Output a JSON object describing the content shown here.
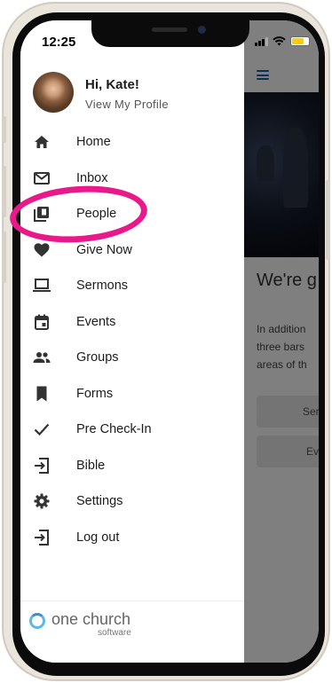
{
  "status_bar": {
    "time": "12:25"
  },
  "user": {
    "greeting": "Hi, Kate!",
    "view_profile": "View My Profile"
  },
  "menu": {
    "items": [
      {
        "label": "Home",
        "icon": "home-icon"
      },
      {
        "label": "Inbox",
        "icon": "mail-icon"
      },
      {
        "label": "People",
        "icon": "people-directory-icon"
      },
      {
        "label": "Give Now",
        "icon": "heart-icon"
      },
      {
        "label": "Sermons",
        "icon": "laptop-icon"
      },
      {
        "label": "Events",
        "icon": "calendar-icon"
      },
      {
        "label": "Groups",
        "icon": "groups-icon"
      },
      {
        "label": "Forms",
        "icon": "bookmark-icon"
      },
      {
        "label": "Pre Check-In",
        "icon": "checkmark-icon"
      },
      {
        "label": "Bible",
        "icon": "exit-to-app-icon"
      },
      {
        "label": "Settings",
        "icon": "gear-icon"
      },
      {
        "label": "Log out",
        "icon": "logout-icon"
      }
    ],
    "highlighted": "People"
  },
  "brand": {
    "name": "one church",
    "sub": "software"
  },
  "background_page": {
    "heading": "We're g",
    "body_lines": [
      "In addition",
      "three bars",
      "areas of th"
    ],
    "button_1": "Ser",
    "button_2": "Ev"
  },
  "colors": {
    "highlight": "#e8198b",
    "accent": "#1f5fa8",
    "brand": "#5cb8e6"
  }
}
